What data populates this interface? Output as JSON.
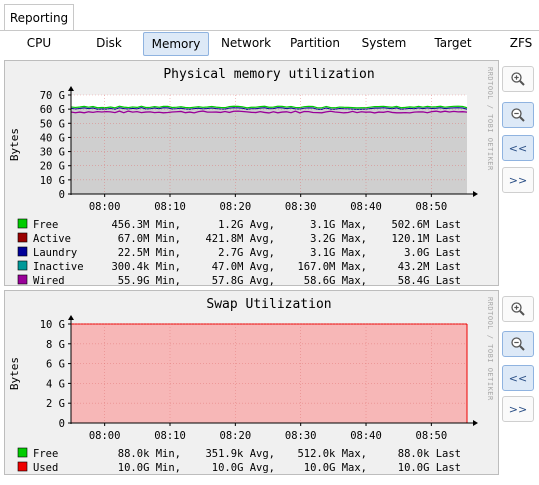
{
  "top_tab": {
    "label": "Reporting"
  },
  "subtabs": [
    "CPU",
    "Disk",
    "Memory",
    "Network",
    "Partition",
    "System",
    "Target",
    "ZFS"
  ],
  "active_subtab": "Memory",
  "watermark": "RRDTOOL / TOBI OETIKER",
  "buttons": {
    "zoom_in": "zoom-in",
    "zoom_out": "zoom-out",
    "back": "<<",
    "forward": ">>"
  },
  "colors": {
    "Free": "#00cc00",
    "Active": "#990000",
    "Laundry": "#000099",
    "Inactive": "#009999",
    "Wired": "#990099",
    "Used": "#ee0000",
    "tab_active_bg": "#dde9f7",
    "tab_active_border": "#8fb3e0"
  },
  "chart_data": [
    {
      "type": "area",
      "title": "Physical memory utilization",
      "ylabel": "Bytes",
      "xlabel": "",
      "yticks": [
        "0",
        "10",
        "20",
        "30",
        "40",
        "50",
        "60",
        "70"
      ],
      "ytick_unit": "G",
      "ylim": [
        0,
        70
      ],
      "xticks": [
        "08:00",
        "08:10",
        "08:20",
        "08:30",
        "08:40",
        "08:50"
      ],
      "grid": true,
      "series": [
        {
          "name": "Free",
          "min": "456.3M",
          "avg": "1.2G",
          "max": "3.1G",
          "last": "502.6M"
        },
        {
          "name": "Active",
          "min": "67.0M",
          "avg": "421.8M",
          "max": "3.2G",
          "last": "120.1M"
        },
        {
          "name": "Laundry",
          "min": "22.5M",
          "avg": "2.7G",
          "max": "3.1G",
          "last": "3.0G"
        },
        {
          "name": "Inactive",
          "min": "300.4k",
          "avg": "47.0M",
          "max": "167.0M",
          "last": "43.2M"
        },
        {
          "name": "Wired",
          "min": "55.9G",
          "avg": "57.8G",
          "max": "58.6G",
          "last": "58.4G"
        }
      ],
      "legend_cols": [
        "Min,",
        "Avg,",
        "Max,",
        "Last"
      ]
    },
    {
      "type": "area",
      "title": "Swap Utilization",
      "ylabel": "Bytes",
      "xlabel": "",
      "yticks": [
        "0",
        "2",
        "4",
        "6",
        "8",
        "10"
      ],
      "ytick_unit": "G",
      "ylim": [
        0,
        10
      ],
      "xticks": [
        "08:00",
        "08:10",
        "08:20",
        "08:30",
        "08:40",
        "08:50"
      ],
      "grid": true,
      "series": [
        {
          "name": "Free",
          "min": "88.0k",
          "avg": "351.9k",
          "max": "512.0k",
          "last": "88.0k"
        },
        {
          "name": "Used",
          "min": "10.0G",
          "avg": "10.0G",
          "max": "10.0G",
          "last": "10.0G"
        }
      ],
      "legend_cols": [
        "Min,",
        "Avg,",
        "Max,",
        "Last"
      ]
    }
  ]
}
